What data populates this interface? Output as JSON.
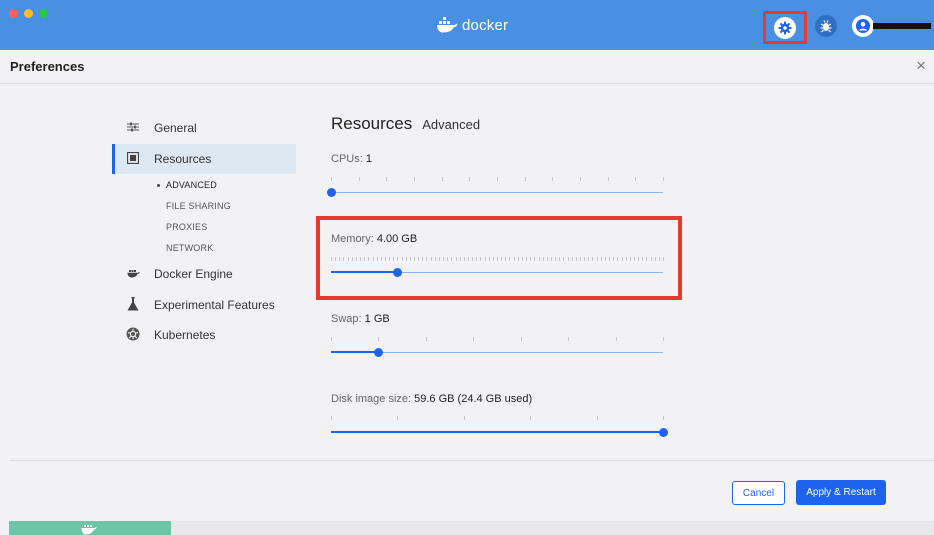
{
  "app": {
    "brand": "docker"
  },
  "header": {
    "title": "Preferences",
    "close_glyph": "×"
  },
  "sidebar": {
    "items": [
      {
        "label": "General",
        "icon": "sliders-icon"
      },
      {
        "label": "Resources",
        "icon": "resources-icon",
        "active": true
      },
      {
        "label": "Docker Engine",
        "icon": "whale-icon"
      },
      {
        "label": "Experimental Features",
        "icon": "flask-icon"
      },
      {
        "label": "Kubernetes",
        "icon": "kubernetes-icon"
      }
    ],
    "subitems": [
      {
        "label": "ADVANCED",
        "active": true
      },
      {
        "label": "FILE SHARING"
      },
      {
        "label": "PROXIES"
      },
      {
        "label": "NETWORK"
      }
    ]
  },
  "main": {
    "title": "Resources",
    "subtitle": "Advanced",
    "cpus": {
      "label": "CPUs:",
      "value": "1",
      "fraction": 0.0
    },
    "memory": {
      "label": "Memory:",
      "value": "4.00 GB",
      "fraction": 0.2
    },
    "swap": {
      "label": "Swap:",
      "value": "1 GB",
      "fraction": 0.143
    },
    "disk": {
      "label": "Disk image size:",
      "value": "59.6 GB (24.4 GB used)",
      "fraction": 1.0
    }
  },
  "footer": {
    "cancel_label": "Cancel",
    "apply_label": "Apply & Restart"
  },
  "colors": {
    "titlebar": "#4a90e2",
    "accent": "#1d63ed",
    "highlight": "#e53b2c",
    "status": "#6cc5a6"
  }
}
